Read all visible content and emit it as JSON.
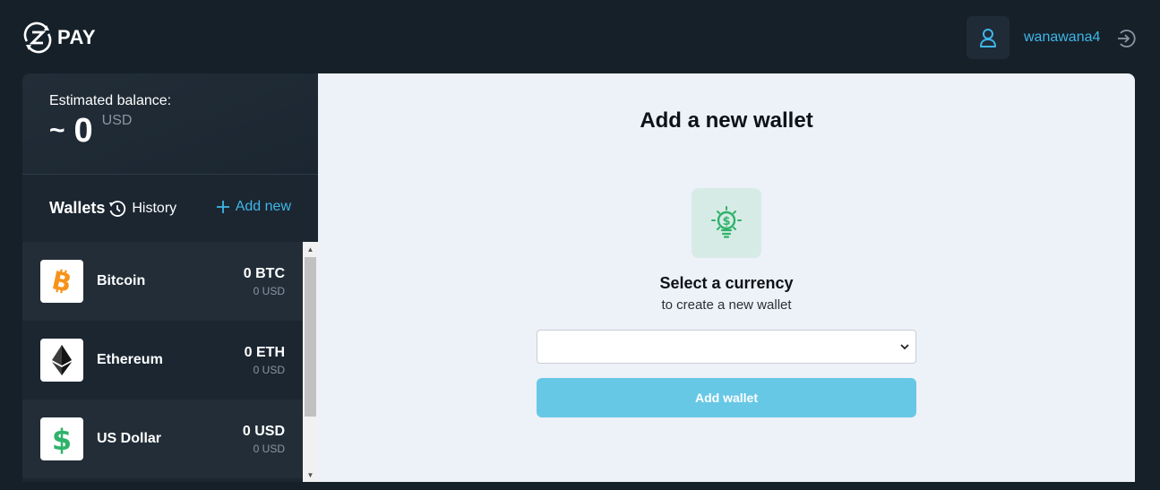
{
  "header": {
    "logo_text": "PAY",
    "username": "wanawana4"
  },
  "balance": {
    "label": "Estimated balance:",
    "tilde": "~",
    "value": "0",
    "currency": "USD"
  },
  "tabs": {
    "wallets": "Wallets",
    "history": "History",
    "add_new": "Add new"
  },
  "wallets": [
    {
      "name": "Bitcoin",
      "amount": "0 BTC",
      "usd": "0 USD",
      "icon": "bitcoin-icon",
      "color": "#f7931a"
    },
    {
      "name": "Ethereum",
      "amount": "0 ETH",
      "usd": "0 USD",
      "icon": "ethereum-icon",
      "color": "#3c3c3d"
    },
    {
      "name": "US Dollar",
      "amount": "0 USD",
      "usd": "0 USD",
      "icon": "dollar-icon",
      "color": "#2fb36b"
    }
  ],
  "main": {
    "title": "Add a new wallet",
    "select_title": "Select a currency",
    "select_subtitle": "to create a new wallet",
    "select_value": "",
    "button_label": "Add wallet"
  },
  "colors": {
    "background": "#162029",
    "accent": "#3fb6e8",
    "button": "#67c8e6",
    "panel": "#edf1f8",
    "bulb": "#2fb36b"
  }
}
